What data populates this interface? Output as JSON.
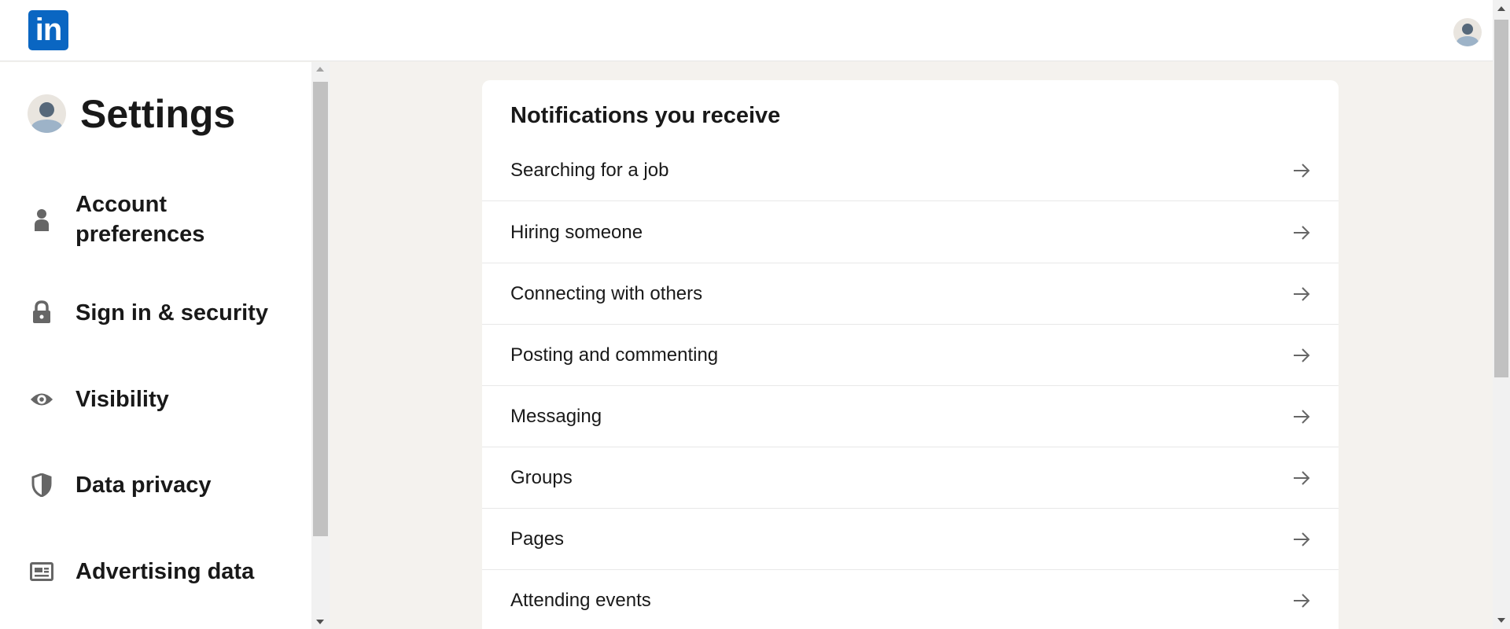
{
  "header": {
    "logo_text": "in",
    "brand_color": "#0a66c2"
  },
  "sidebar": {
    "title": "Settings",
    "items": [
      {
        "label": "Account preferences",
        "icon": "person-icon"
      },
      {
        "label": "Sign in & security",
        "icon": "lock-icon"
      },
      {
        "label": "Visibility",
        "icon": "eye-icon"
      },
      {
        "label": "Data privacy",
        "icon": "shield-icon"
      },
      {
        "label": "Advertising data",
        "icon": "newspaper-icon"
      }
    ]
  },
  "main": {
    "card_title": "Notifications you receive",
    "rows": [
      {
        "label": "Searching for a job"
      },
      {
        "label": "Hiring someone"
      },
      {
        "label": "Connecting with others"
      },
      {
        "label": "Posting and commenting"
      },
      {
        "label": "Messaging"
      },
      {
        "label": "Groups"
      },
      {
        "label": "Pages"
      },
      {
        "label": "Attending events"
      }
    ]
  }
}
